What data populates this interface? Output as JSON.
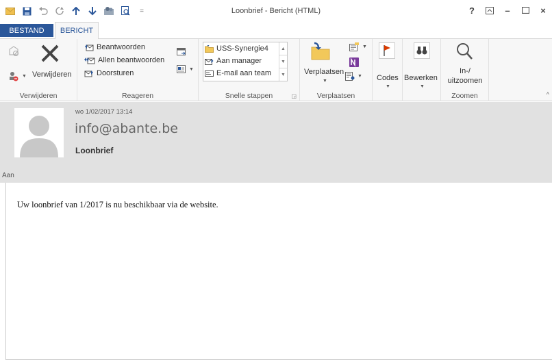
{
  "window": {
    "title": "Loonbrief - Bericht (HTML)",
    "controls": [
      "?",
      "⊼",
      "–",
      "☐",
      "×"
    ]
  },
  "tabs": [
    {
      "label": "BESTAND",
      "active": false
    },
    {
      "label": "BERICHT",
      "active": true
    }
  ],
  "ribbon": {
    "groups": {
      "verwijderen": {
        "label": "Verwijderen",
        "delete_label": "Verwijderen"
      },
      "reageren": {
        "label": "Reageren",
        "reply": "Beantwoorden",
        "reply_all": "Allen beantwoorden",
        "forward": "Doorsturen"
      },
      "snelle_stappen": {
        "label": "Snelle stappen",
        "items": [
          "USS-Synergie4",
          "Aan manager",
          "E-mail aan team"
        ]
      },
      "verplaatsen": {
        "label": "Verplaatsen",
        "move_label": "Verplaatsen"
      },
      "codes": {
        "label": "Codes"
      },
      "bewerken": {
        "label": "Bewerken"
      },
      "zoomen": {
        "label": "Zoomen",
        "zoom_line1": "In-/",
        "zoom_line2": "uitzoomen"
      }
    }
  },
  "message": {
    "date": "wo 1/02/2017 13:14",
    "sender": "info@abante.be",
    "subject": "Loonbrief",
    "to_label": "Aan",
    "body": "Uw loonbrief van 1/2017 is nu beschikbaar via de website."
  },
  "colors": {
    "accent": "#2b579a",
    "header_bg": "#e1e1e1",
    "ribbon_bg": "#f7f7f7"
  }
}
